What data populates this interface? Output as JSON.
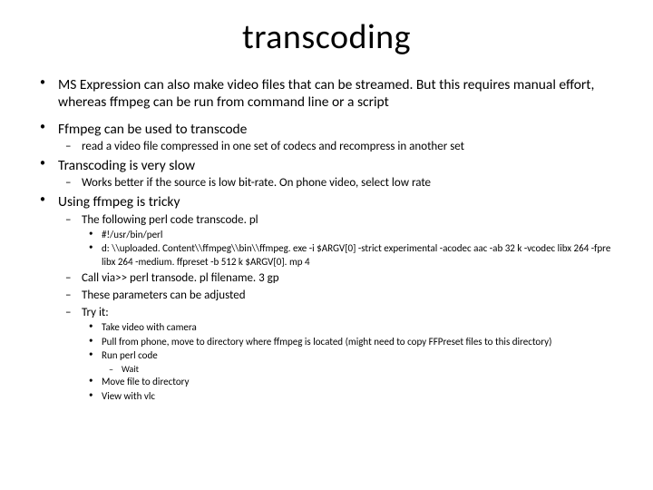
{
  "title": "transcoding",
  "bullets": {
    "b1": "MS Expression can also make video files that can be streamed. But this requires manual effort, whereas ffmpeg can be run from command line or a script",
    "b2": "Ffmpeg can be used to transcode",
    "b2_1": "read a video file compressed in one set of codecs and recompress in another set",
    "b3": "Transcoding is very slow",
    "b3_1": "Works better if the source is low bit-rate. On phone video, select low rate",
    "b4": "Using ffmpeg is tricky",
    "b4_1": "The following perl code transcode. pl",
    "b4_1_1": "#!/usr/bin/perl",
    "b4_1_2": "d: \\\\uploaded. Content\\\\ffmpeg\\\\bin\\\\ffmpeg. exe -i $ARGV[0] -strict experimental -acodec aac -ab 32 k -vcodec libx 264 -fpre libx 264 -medium. ffpreset -b 512 k $ARGV[0]. mp 4",
    "b4_2": "Call via>> perl transode. pl filename. 3 gp",
    "b4_3": "These parameters can be adjusted",
    "b4_4": "Try it:",
    "b4_4_1": "Take video with camera",
    "b4_4_2": "Pull from phone, move to directory where ffmpeg is located (might need to copy FFPreset files to this directory)",
    "b4_4_3": "Run perl code",
    "b4_4_3_1": "Wait",
    "b4_4_4": "Move file to directory",
    "b4_4_5": "View with vlc"
  }
}
